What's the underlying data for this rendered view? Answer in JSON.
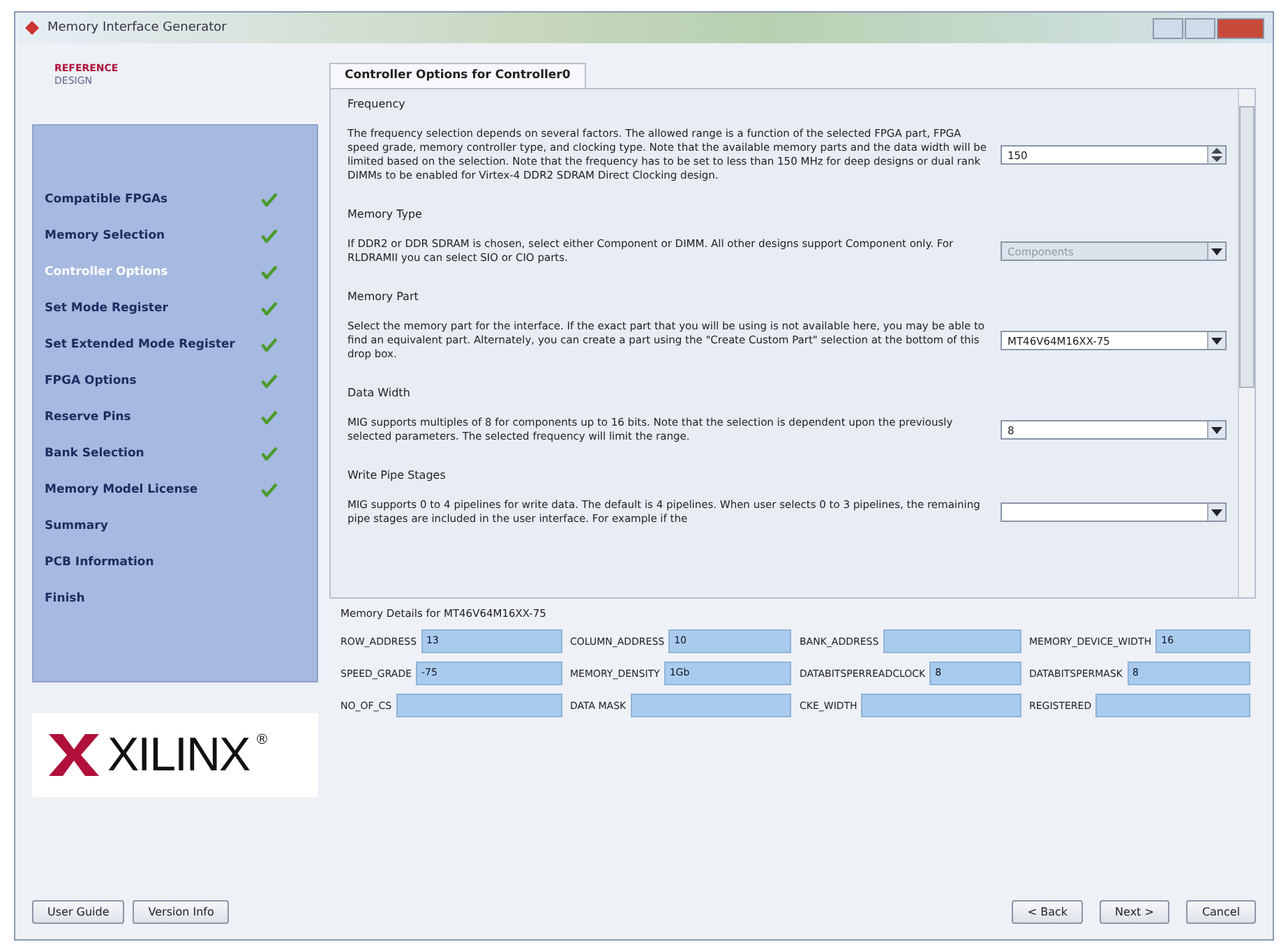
{
  "window": {
    "title": "Memory Interface Generator"
  },
  "reference_logo": {
    "line_1": "REFERENCE",
    "line_2": "DESIGN"
  },
  "sidebar": {
    "items": [
      {
        "label": "Compatible FPGAs",
        "selected": false,
        "done": true
      },
      {
        "label": "Memory Selection",
        "selected": false,
        "done": true
      },
      {
        "label": "Controller Options",
        "selected": true,
        "done": true
      },
      {
        "label": "Set Mode Register",
        "selected": false,
        "done": true
      },
      {
        "label": "Set Extended Mode Register",
        "selected": false,
        "done": true
      },
      {
        "label": "FPGA Options",
        "selected": false,
        "done": true
      },
      {
        "label": "Reserve Pins",
        "selected": false,
        "done": true
      },
      {
        "label": "Bank Selection",
        "selected": false,
        "done": true
      },
      {
        "label": "Memory Model License",
        "selected": false,
        "done": true
      },
      {
        "label": "Summary",
        "selected": false,
        "done": false
      },
      {
        "label": "PCB Information",
        "selected": false,
        "done": false
      },
      {
        "label": "Finish",
        "selected": false,
        "done": false
      }
    ]
  },
  "brand_logo": {
    "text": "XILINX",
    "mark": "®"
  },
  "tab": {
    "label": "Controller Options for Controller0"
  },
  "sections": [
    {
      "title": "Frequency",
      "text": "The frequency selection depends on several factors. The allowed range is a function of the selected FPGA part, FPGA speed grade, memory controller type, and clocking type. Note that the available memory parts and the data width will be limited based on the selection. Note that the frequency has to be set to less than 150 MHz for deep designs or dual rank DIMMs to be enabled for Virtex-4 DDR2 SDRAM Direct Clocking design.",
      "kind": "spin",
      "value": "150",
      "disabled": false
    },
    {
      "title": "Memory Type",
      "text": "If DDR2 or DDR SDRAM is chosen, select either Component or DIMM. All other designs support Component only. For RLDRAMII you can select SIO or CIO parts.",
      "kind": "dropdown",
      "value": "Components",
      "disabled": true
    },
    {
      "title": "Memory Part",
      "text": "Select the memory part for the interface. If the exact part that you will be using is not available here, you may be able to find an equivalent part. Alternately, you can create a part using the \"Create Custom Part\" selection at the bottom of this drop box.",
      "kind": "dropdown",
      "value": "MT46V64M16XX-75",
      "disabled": false
    },
    {
      "title": "Data Width",
      "text": "MIG supports multiples of 8 for components up to 16 bits. Note that the selection is dependent upon the previously selected parameters. The selected frequency will limit the range.",
      "kind": "dropdown",
      "value": "8",
      "disabled": false
    },
    {
      "title": "Write Pipe Stages",
      "text": "MIG supports 0 to 4 pipelines for write data. The default is 4 pipelines. When user selects 0 to 3 pipelines, the remaining pipe stages are included in the user interface. For example if the",
      "kind": "dropdown",
      "disabled": false
    }
  ],
  "memory_details": {
    "title": "Memory Details for MT46V64M16XX-75",
    "fields": [
      {
        "label": "ROW_ADDRESS",
        "value": "13"
      },
      {
        "label": "COLUMN_ADDRESS",
        "value": "10"
      },
      {
        "label": "BANK_ADDRESS"
      },
      {
        "label": "MEMORY_DEVICE_WIDTH",
        "value": "16"
      },
      {
        "label": "SPEED_GRADE",
        "value": "-75"
      },
      {
        "label": "MEMORY_DENSITY",
        "value": "1Gb"
      },
      {
        "label": "DATABITSPERREADCLOCK",
        "value": "8"
      },
      {
        "label": "DATABITSPERMASK",
        "value": "8"
      },
      {
        "label": "NO_OF_CS"
      },
      {
        "label": "DATA MASK"
      },
      {
        "label": "CKE_WIDTH"
      },
      {
        "label": "REGISTERED"
      }
    ]
  },
  "buttons": {
    "left": [
      "User Guide",
      "Version Info"
    ],
    "right": [
      "< Back",
      "Next >",
      "Cancel"
    ]
  }
}
